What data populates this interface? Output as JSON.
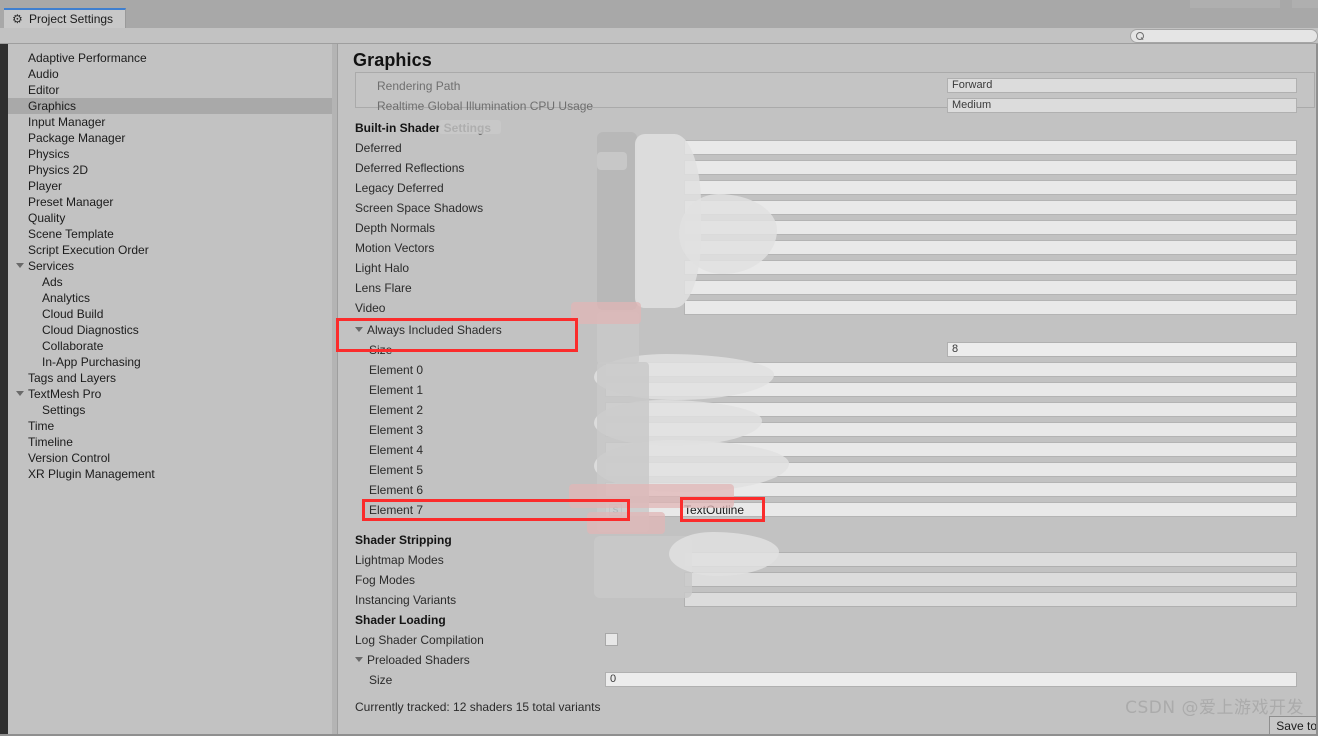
{
  "window": {
    "tab_label": "Project Settings",
    "tab_icon": "gear-icon"
  },
  "search": {
    "value": "",
    "placeholder": "",
    "icon": "search-icon"
  },
  "sidebar": {
    "items": [
      {
        "label": "Adaptive Performance",
        "indent": 0,
        "expander": false,
        "selected": false
      },
      {
        "label": "Audio",
        "indent": 0,
        "expander": false,
        "selected": false
      },
      {
        "label": "Editor",
        "indent": 0,
        "expander": false,
        "selected": false
      },
      {
        "label": "Graphics",
        "indent": 0,
        "expander": false,
        "selected": true
      },
      {
        "label": "Input Manager",
        "indent": 0,
        "expander": false,
        "selected": false
      },
      {
        "label": "Package Manager",
        "indent": 0,
        "expander": false,
        "selected": false
      },
      {
        "label": "Physics",
        "indent": 0,
        "expander": false,
        "selected": false
      },
      {
        "label": "Physics 2D",
        "indent": 0,
        "expander": false,
        "selected": false
      },
      {
        "label": "Player",
        "indent": 0,
        "expander": false,
        "selected": false
      },
      {
        "label": "Preset Manager",
        "indent": 0,
        "expander": false,
        "selected": false
      },
      {
        "label": "Quality",
        "indent": 0,
        "expander": false,
        "selected": false
      },
      {
        "label": "Scene Template",
        "indent": 0,
        "expander": false,
        "selected": false
      },
      {
        "label": "Script Execution Order",
        "indent": 0,
        "expander": false,
        "selected": false
      },
      {
        "label": "Services",
        "indent": 0,
        "expander": true,
        "selected": false
      },
      {
        "label": "Ads",
        "indent": 1,
        "expander": false,
        "selected": false
      },
      {
        "label": "Analytics",
        "indent": 1,
        "expander": false,
        "selected": false
      },
      {
        "label": "Cloud Build",
        "indent": 1,
        "expander": false,
        "selected": false
      },
      {
        "label": "Cloud Diagnostics",
        "indent": 1,
        "expander": false,
        "selected": false
      },
      {
        "label": "Collaborate",
        "indent": 1,
        "expander": false,
        "selected": false
      },
      {
        "label": "In-App Purchasing",
        "indent": 1,
        "expander": false,
        "selected": false
      },
      {
        "label": "Tags and Layers",
        "indent": 0,
        "expander": false,
        "selected": false
      },
      {
        "label": "TextMesh Pro",
        "indent": 0,
        "expander": true,
        "selected": false
      },
      {
        "label": "Settings",
        "indent": 1,
        "expander": false,
        "selected": false
      },
      {
        "label": "Time",
        "indent": 0,
        "expander": false,
        "selected": false
      },
      {
        "label": "Timeline",
        "indent": 0,
        "expander": false,
        "selected": false
      },
      {
        "label": "Version Control",
        "indent": 0,
        "expander": false,
        "selected": false
      },
      {
        "label": "XR Plugin Management",
        "indent": 0,
        "expander": false,
        "selected": false
      }
    ]
  },
  "main": {
    "title": "Graphics",
    "tier_rows": [
      {
        "label": "Rendering Path",
        "value": "Forward"
      },
      {
        "label": "Realtime Global Illumination CPU Usage",
        "value": "Medium"
      }
    ],
    "builtin_header": "Built-in Shader Settings",
    "builtin_rows": [
      {
        "label": "Deferred",
        "value": ""
      },
      {
        "label": "Deferred Reflections",
        "value": ""
      },
      {
        "label": "Legacy Deferred",
        "value": ""
      },
      {
        "label": "Screen Space Shadows",
        "value": ""
      },
      {
        "label": "Depth Normals",
        "value": ""
      },
      {
        "label": "Motion Vectors",
        "value": ""
      },
      {
        "label": "Light Halo",
        "value": ""
      },
      {
        "label": "Lens Flare",
        "value": ""
      },
      {
        "label": "Video",
        "value": ""
      }
    ],
    "always_included": {
      "header": "Always Included Shaders",
      "size_label": "Size",
      "size_value": "8",
      "elements": [
        {
          "label": "Element 0",
          "value": ""
        },
        {
          "label": "Element 1",
          "value": ""
        },
        {
          "label": "Element 2",
          "value": ""
        },
        {
          "label": "Element 3",
          "value": ""
        },
        {
          "label": "Element 4",
          "value": ""
        },
        {
          "label": "Element 5",
          "value": ""
        },
        {
          "label": "Element 6",
          "value": ""
        },
        {
          "label": "Element 7",
          "value": "TextOutline"
        }
      ]
    },
    "shader_stripping": {
      "header": "Shader Stripping",
      "rows": [
        {
          "label": "Lightmap Modes",
          "value": ""
        },
        {
          "label": "Fog Modes",
          "value": ""
        },
        {
          "label": "Instancing Variants",
          "value": ""
        }
      ]
    },
    "shader_loading": {
      "header": "Shader Loading",
      "log_shader_compilation_label": "Log Shader Compilation",
      "log_shader_compilation_checked": false,
      "preloaded_header": "Preloaded Shaders",
      "preloaded_size_label": "Size",
      "preloaded_size_value": "0",
      "tracked_text": "Currently tracked: 12 shaders 15 total variants"
    },
    "save_button_label": "Save to"
  },
  "watermark": {
    "text": "CSDN @爱上游戏开发"
  },
  "colors": {
    "panel_bg": "#c2c2c2",
    "chrome_bg": "#a8a8a8",
    "selection": "#a9a9a9",
    "tab_accent": "#3e7fd0",
    "annotation_red": "#fb2c2c",
    "field_bg": "#e6e6e6",
    "text": "#1b1b1b",
    "text_dim": "#6f6f6f"
  }
}
